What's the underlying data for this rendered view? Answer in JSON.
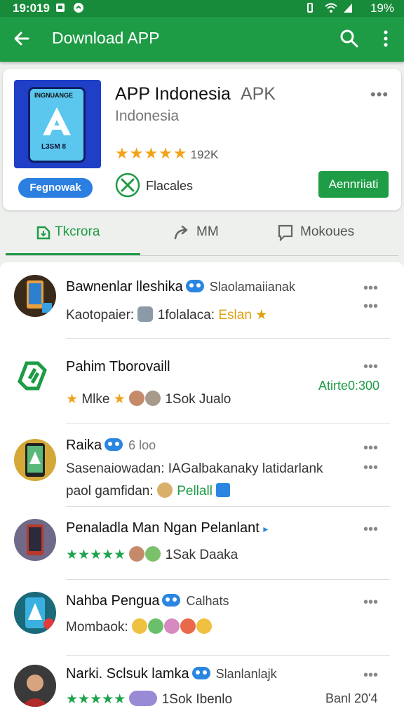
{
  "status": {
    "time": "19:019",
    "battery": "19%"
  },
  "appbar": {
    "title": "Download APP"
  },
  "app": {
    "icon_top_text": "INGNUANGE",
    "icon_bottom_text": "L3SM 8",
    "name": "APP Indonesia",
    "type": "APK",
    "subtitle": "Indonesia",
    "stars": "★★★★★",
    "rating_count": "192K",
    "pill_label": "Fegnowak",
    "feature_label": "Flacales",
    "install_label": "Aennriiati"
  },
  "tabs": [
    {
      "label": "Tkcrora",
      "icon": "download-icon"
    },
    {
      "label": "MM",
      "icon": "share-icon"
    },
    {
      "label": "Mokoues",
      "icon": "comment-icon"
    }
  ],
  "list": [
    {
      "name": "Bawnenlar lleshika",
      "extra": "Slaolamaiianak",
      "line2_a": "Kaotopaier:",
      "line2_b": "1folalaca:",
      "line2_c": "Eslan",
      "dots_top": "•••",
      "dots_bottom": "•••"
    },
    {
      "name": "Pahim Tborovaill",
      "stars": "★",
      "line2_a": "Mlke",
      "line2_b": "1Sok Jualo",
      "meta": "Atirte0:300",
      "dots_top": "•••"
    },
    {
      "name": "Raika",
      "extra": "6 loo",
      "line2": "Sasenaiowadan: IAGalbakanaky latidarlank",
      "line3_a": "paol gamfidan:",
      "line3_b": "Pellall",
      "dots_top": "•••",
      "dots_bottom": "•••"
    },
    {
      "name": "Penaladla Man Ngan Pelanlant",
      "stars": "★★★★★",
      "line2_b": "1Sak Daaka",
      "dots_top": "•••"
    },
    {
      "name": "Nahba Pengua",
      "extra": "Calhats",
      "line2_a": "Mombaok:",
      "dots_top": "•••"
    },
    {
      "name": "Narki. Sclsuk lamka",
      "extra": "Slanlanlajk",
      "stars": "★★★★★",
      "line2_b": "1Sok Ibenlo",
      "meta": "Banl 20'4",
      "dots_top": "•••"
    }
  ],
  "colors": {
    "brand_green": "#1e9b45",
    "star": "#f2a21a",
    "link_blue": "#2a86e0"
  }
}
